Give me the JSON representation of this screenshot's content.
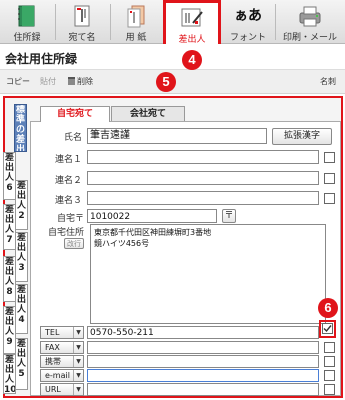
{
  "toolbar": {
    "items": [
      {
        "label": "住所録",
        "icon": "address-book-icon"
      },
      {
        "label": "宛て名",
        "icon": "addressee-icon"
      },
      {
        "label": "用 紙",
        "icon": "paper-icon"
      },
      {
        "label": "差出人",
        "icon": "sender-icon"
      },
      {
        "label": "フォント",
        "icon": "font-icon",
        "glyph": "ぁあ"
      },
      {
        "label": "印刷・メール",
        "icon": "printer-mail-icon"
      }
    ],
    "active": "差出人"
  },
  "callouts": [
    "4",
    "5",
    "6"
  ],
  "title": "会社用住所録",
  "subbar": {
    "copy": "コピー",
    "paste": "貼付",
    "delete": "削除",
    "name_label": "名刺"
  },
  "side_tabs": [
    {
      "label": "標準の差出人",
      "active": true
    },
    {
      "label": "差出人6"
    },
    {
      "label": "差出人2"
    },
    {
      "label": "差出人7"
    },
    {
      "label": "差出人3"
    },
    {
      "label": "差出人8"
    },
    {
      "label": "差出人4"
    },
    {
      "label": "差出人9"
    },
    {
      "label": "差出人5"
    },
    {
      "label": "差出人10"
    }
  ],
  "tabs": [
    {
      "label": "自宅宛て",
      "active": true
    },
    {
      "label": "会社宛て"
    }
  ],
  "form": {
    "name_label": "氏名",
    "name_value": "筆吉遠謹",
    "ext_kanji_button": "拡張漢字",
    "joint_labels": [
      "連名１",
      "連名２",
      "連名３"
    ],
    "postal_label": "自宅〒",
    "postal_value": "1010022",
    "postal_button": "〒",
    "address_label": "自宅住所",
    "address_linebreak_button": "改行",
    "address_lines": [
      "東京都千代田区神田練塀町3番地",
      "鏡ハイツ456号"
    ],
    "contacts": [
      {
        "label": "TEL",
        "value": "0570-550-211",
        "checked": true
      },
      {
        "label": "FAX",
        "value": "",
        "checked": false
      },
      {
        "label": "携帯",
        "value": "",
        "checked": false
      },
      {
        "label": "e-mail",
        "value": "",
        "checked": false
      },
      {
        "label": "URL",
        "value": "",
        "checked": false
      }
    ]
  },
  "colors": {
    "accent_red": "#e0141a",
    "active_side_tab": "#5c80b8"
  }
}
